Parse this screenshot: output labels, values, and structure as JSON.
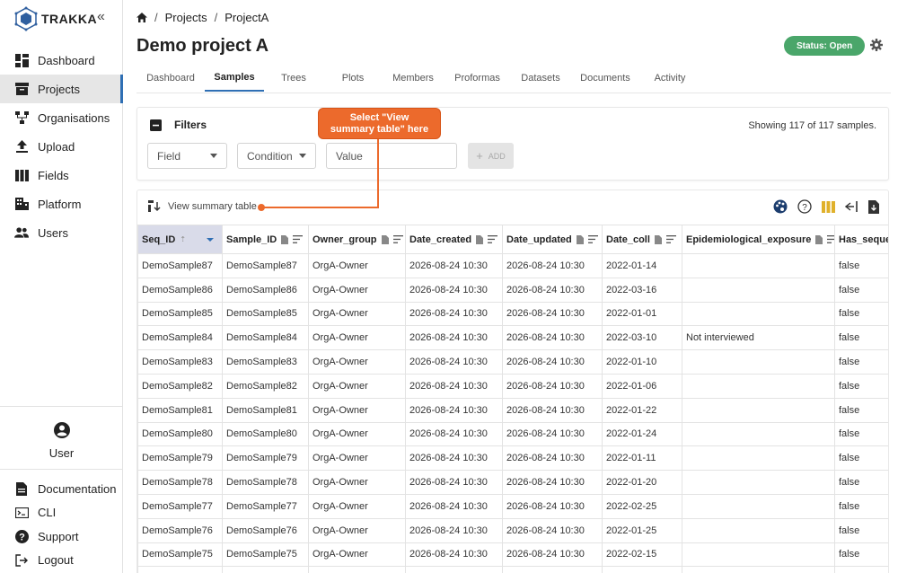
{
  "app": {
    "logo_text": "TRAKKA"
  },
  "sidebar": {
    "items": [
      {
        "label": "Dashboard",
        "icon": "dashboard-icon"
      },
      {
        "label": "Projects",
        "icon": "projects-icon",
        "active": true
      },
      {
        "label": "Organisations",
        "icon": "organisations-icon"
      },
      {
        "label": "Upload",
        "icon": "upload-icon"
      },
      {
        "label": "Fields",
        "icon": "fields-icon"
      },
      {
        "label": "Platform",
        "icon": "platform-icon"
      },
      {
        "label": "Users",
        "icon": "users-icon"
      }
    ],
    "user_label": "User",
    "bottom_items": [
      {
        "label": "Documentation",
        "icon": "documentation-icon"
      },
      {
        "label": "CLI",
        "icon": "cli-icon"
      },
      {
        "label": "Support",
        "icon": "support-icon"
      },
      {
        "label": "Logout",
        "icon": "logout-icon"
      }
    ]
  },
  "breadcrumb": {
    "items": [
      "Projects",
      "ProjectA"
    ]
  },
  "page": {
    "title": "Demo project A",
    "status": "Status: Open"
  },
  "tabs": [
    "Dashboard",
    "Samples",
    "Trees",
    "Plots",
    "Members",
    "Proformas",
    "Datasets",
    "Documents",
    "Activity"
  ],
  "active_tab": "Samples",
  "filters": {
    "title": "Filters",
    "showing": "Showing 117 of 117 samples.",
    "field_placeholder": "Field",
    "condition_placeholder": "Condition",
    "value_placeholder": "Value",
    "add_label": "ADD"
  },
  "callout": {
    "line1": "Select \"View",
    "line2": "summary table\" here"
  },
  "table": {
    "view_summary_label": "View summary table",
    "columns": [
      "Seq_ID",
      "Sample_ID",
      "Owner_group",
      "Date_created",
      "Date_updated",
      "Date_coll",
      "Epidemiological_exposure",
      "Has_sequen"
    ],
    "rows": [
      [
        "DemoSample87",
        "DemoSample87",
        "OrgA-Owner",
        "2026-08-24 10:30",
        "2026-08-24 10:30",
        "2022-01-14",
        "",
        "false"
      ],
      [
        "DemoSample86",
        "DemoSample86",
        "OrgA-Owner",
        "2026-08-24 10:30",
        "2026-08-24 10:30",
        "2022-03-16",
        "",
        "false"
      ],
      [
        "DemoSample85",
        "DemoSample85",
        "OrgA-Owner",
        "2026-08-24 10:30",
        "2026-08-24 10:30",
        "2022-01-01",
        "",
        "false"
      ],
      [
        "DemoSample84",
        "DemoSample84",
        "OrgA-Owner",
        "2026-08-24 10:30",
        "2026-08-24 10:30",
        "2022-03-10",
        "Not interviewed",
        "false"
      ],
      [
        "DemoSample83",
        "DemoSample83",
        "OrgA-Owner",
        "2026-08-24 10:30",
        "2026-08-24 10:30",
        "2022-01-10",
        "",
        "false"
      ],
      [
        "DemoSample82",
        "DemoSample82",
        "OrgA-Owner",
        "2026-08-24 10:30",
        "2026-08-24 10:30",
        "2022-01-06",
        "",
        "false"
      ],
      [
        "DemoSample81",
        "DemoSample81",
        "OrgA-Owner",
        "2026-08-24 10:30",
        "2026-08-24 10:30",
        "2022-01-22",
        "",
        "false"
      ],
      [
        "DemoSample80",
        "DemoSample80",
        "OrgA-Owner",
        "2026-08-24 10:30",
        "2026-08-24 10:30",
        "2022-01-24",
        "",
        "false"
      ],
      [
        "DemoSample79",
        "DemoSample79",
        "OrgA-Owner",
        "2026-08-24 10:30",
        "2026-08-24 10:30",
        "2022-01-11",
        "",
        "false"
      ],
      [
        "DemoSample78",
        "DemoSample78",
        "OrgA-Owner",
        "2026-08-24 10:30",
        "2026-08-24 10:30",
        "2022-01-20",
        "",
        "false"
      ],
      [
        "DemoSample77",
        "DemoSample77",
        "OrgA-Owner",
        "2026-08-24 10:30",
        "2026-08-24 10:30",
        "2022-02-25",
        "",
        "false"
      ],
      [
        "DemoSample76",
        "DemoSample76",
        "OrgA-Owner",
        "2026-08-24 10:30",
        "2026-08-24 10:30",
        "2022-01-25",
        "",
        "false"
      ],
      [
        "DemoSample75",
        "DemoSample75",
        "OrgA-Owner",
        "2026-08-24 10:30",
        "2026-08-24 10:30",
        "2022-02-15",
        "",
        "false"
      ],
      [
        "",
        "",
        "",
        "",
        "",
        "",
        "",
        ""
      ]
    ]
  },
  "colors": {
    "accent": "#2f6fb4",
    "status": "#4aa66a",
    "callout": "#ec6a2c",
    "sorted_header": "#d9dbe9"
  }
}
